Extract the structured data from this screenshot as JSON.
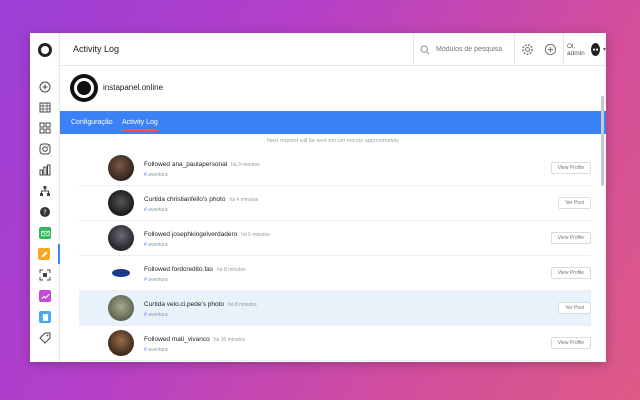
{
  "topbar": {
    "title": "Activity Log",
    "search_placeholder": "Módulos de pesquisa",
    "username": "Ol, admin",
    "avatar_text": "●●"
  },
  "profile": {
    "name": "instapanel.online"
  },
  "tabs": [
    {
      "label": "Configuração"
    },
    {
      "label": "Activity Log",
      "active": true
    }
  ],
  "notice": "Next request will be sent em um minuto approximately",
  "rows": [
    {
      "action": "Followed",
      "user": "ana_paulapersonal",
      "time": "há 3 minutos",
      "tag": "aventura",
      "button": "View Profile",
      "avatar_color": "#3a2a22"
    },
    {
      "action": "Curtida",
      "user": "christianfello's photo",
      "time": "há 4 minutos",
      "tag": "aventura",
      "button": "Ver Post",
      "avatar_color": "#1f1f1f"
    },
    {
      "action": "Followed",
      "user": "josephkingelverdadero",
      "time": "há 5 minutos",
      "tag": "aventura",
      "button": "View Profile",
      "avatar_color": "#2e2e36"
    },
    {
      "action": "Followed",
      "user": "fordcredito.fas",
      "time": "há 8 minutos",
      "tag": "aventura",
      "button": "View Profile",
      "avatar_color": "#ffffff"
    },
    {
      "action": "Curtida",
      "user": "velo.ci.pede's photo",
      "time": "há 8 minutos",
      "tag": "aventura",
      "button": "Ver Post",
      "avatar_color": "#6b6e5a"
    },
    {
      "action": "Followed",
      "user": "mati_vivanco",
      "time": "há 10 minutos",
      "tag": "aventura",
      "button": "View Profile",
      "avatar_color": "#4a3324"
    }
  ],
  "colors": {
    "accent": "#3b82f6",
    "tab_underline": "#ff4d5a",
    "highlight_row": "#e9f1fb"
  },
  "rail_icons": [
    "plus-circle-icon",
    "calendar-icon",
    "grid-icon",
    "instagram-icon",
    "bar-chart-icon",
    "sitemap-icon",
    "help-icon",
    "mail-icon",
    "pencil-icon",
    "scan-icon",
    "trend-icon",
    "document-icon",
    "tag-icon"
  ]
}
